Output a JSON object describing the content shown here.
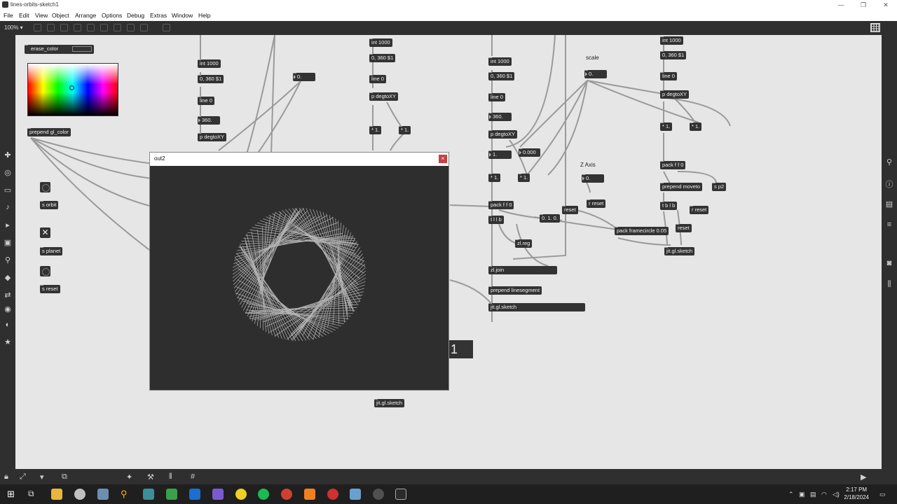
{
  "window": {
    "title": "lines-orbits-sketch1"
  },
  "menu": [
    "File",
    "Edit",
    "View",
    "Object",
    "Arrange",
    "Options",
    "Debug",
    "Extras",
    "Window",
    "Help"
  ],
  "toolbar": {
    "zoom": "100% ▾"
  },
  "canvas": {
    "attr_erase_color": "erase_color",
    "prepend_gl_color": "prepend gl_color",
    "s_orbit": "s orbit",
    "s_planet": "s planet",
    "s_reset": "s reset",
    "col1": {
      "int": "int 1000",
      "msg": "0, 360 $1",
      "line": "line 0",
      "num": "360.",
      "degto": "p degtoXY"
    },
    "col2": {
      "int": "int 1000",
      "msg": "0, 360 $1",
      "line": "line 0",
      "degto": "p degtoXY",
      "mul1": "* 1.",
      "mul2": "* 1."
    },
    "col3": {
      "int": "int 1000",
      "msg": "0, 360 $1",
      "line": "line 0",
      "num": "360.",
      "degto": "p degtoXY",
      "f1": "1.",
      "f2": "0.000",
      "mul1": "* 1.",
      "mul2": "* 1.",
      "pack": "pack f f 0",
      "tlb": "t l l b",
      "zlreg": "zl.reg",
      "zljoin": "zl.join",
      "prepend": "prepend linesegment",
      "sketch": "jit.gl.sketch"
    },
    "col4": {
      "int": "int 1000",
      "msg": "0, 360 $1",
      "line": "line 0",
      "degto": "p degtoXY",
      "mul1": "* 1.",
      "mul2": "* 1.",
      "pack": "pack f f 0",
      "prepend": "prepend moveto",
      "sp2": "s p2",
      "tblb": "t b l b",
      "rreset": "r reset",
      "reset": "reset",
      "packframe": "pack framecircle 0.05",
      "sketch": "jit.gl.sketch"
    },
    "num_a": "0.",
    "scale_label": "scale",
    "scale_num": "0.",
    "zaxis_label": "Z Axis",
    "zaxis_num": "0.",
    "reset_a": "reset",
    "rreset_a": "r reset",
    "msg_010": "0. 1. 0.",
    "sketch_bottom": "jit.gl.sketch",
    "big_number": "1"
  },
  "output_window": {
    "title": "out2",
    "close": "×"
  },
  "taskbar": {
    "time": "2:17 PM",
    "date": "2/18/2024"
  }
}
